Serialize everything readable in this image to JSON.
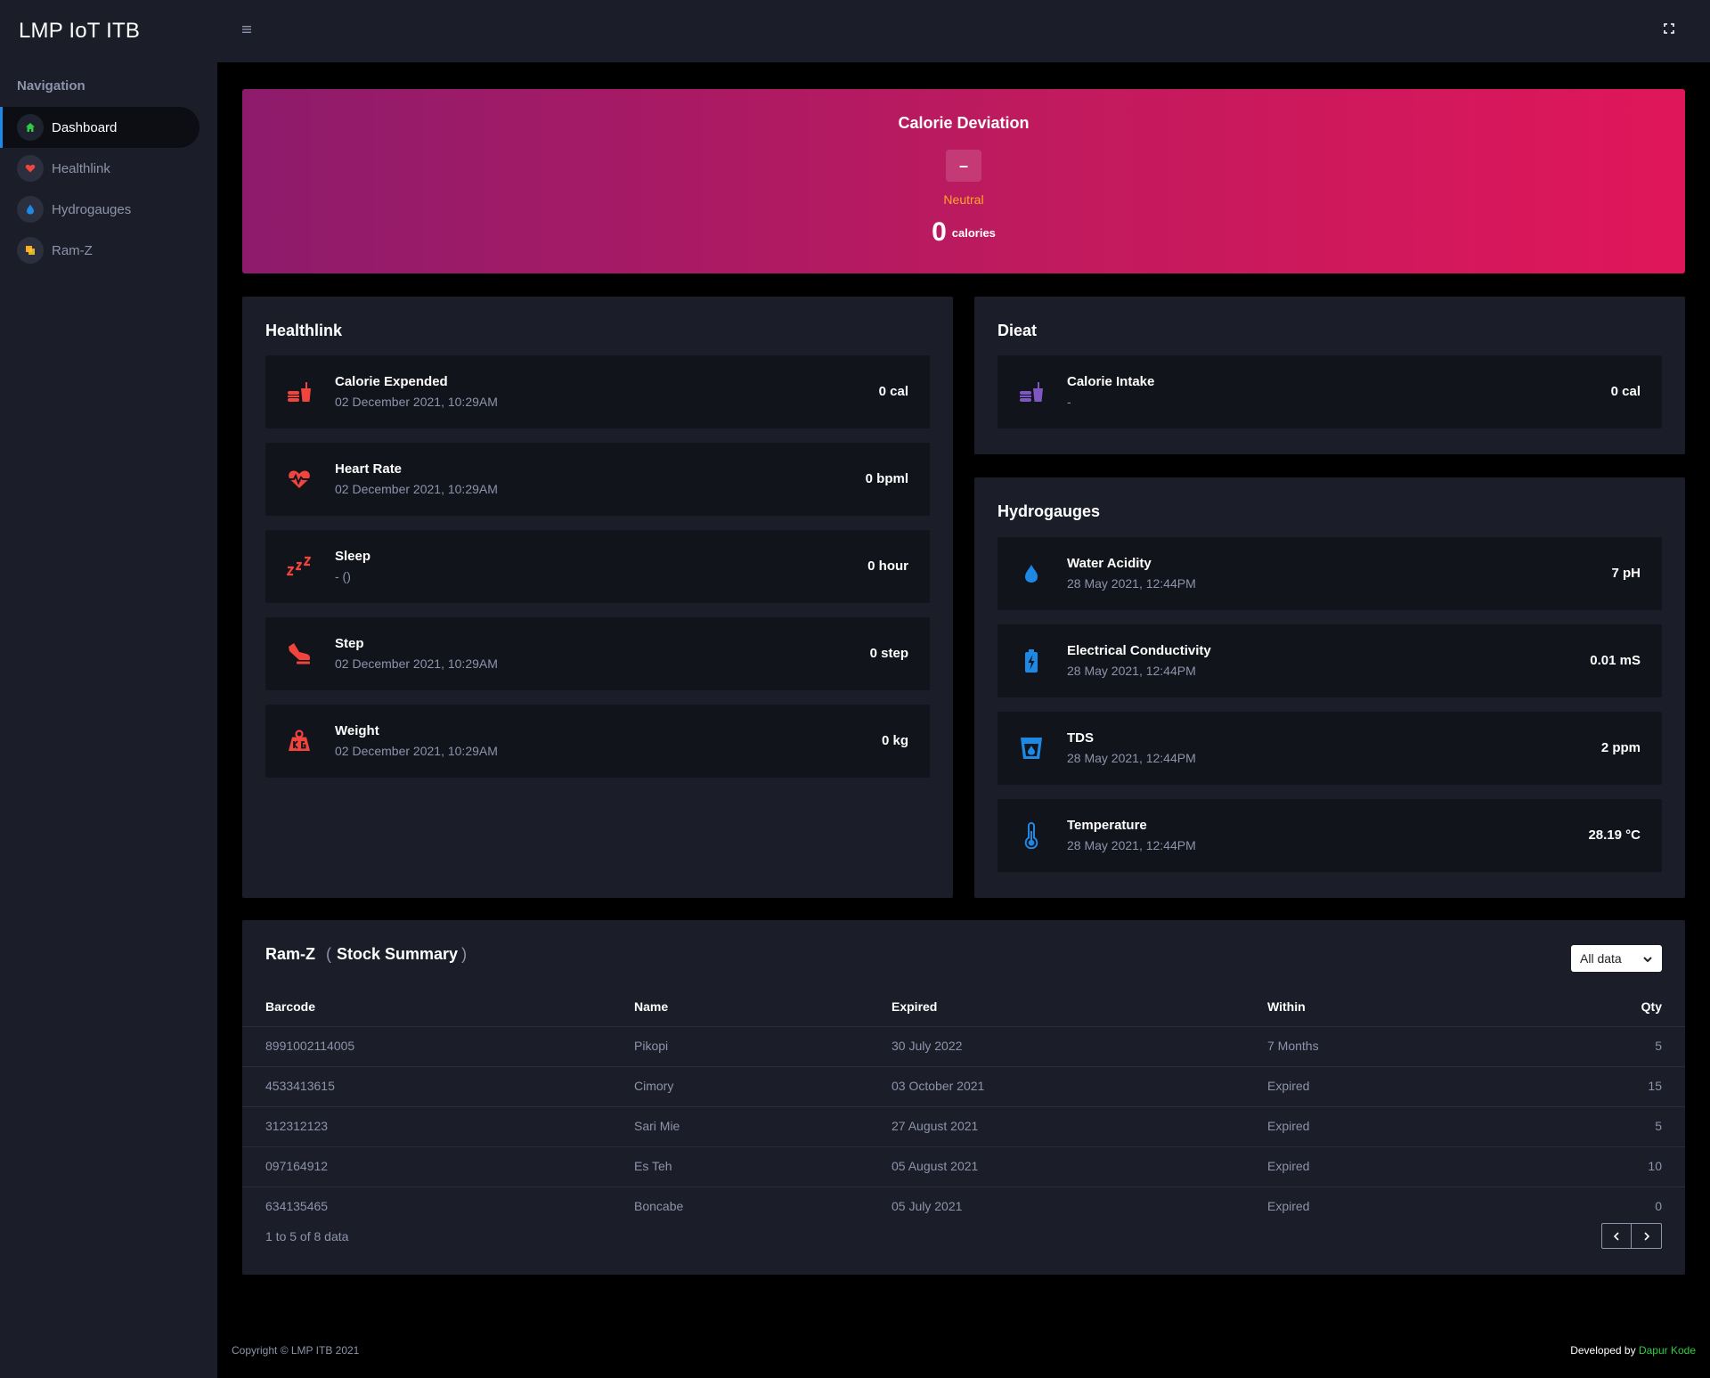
{
  "app": {
    "title": "LMP IoT ITB"
  },
  "sidebar": {
    "nav_title": "Navigation",
    "items": [
      {
        "label": "Dashboard",
        "icon": "home-icon",
        "active": true
      },
      {
        "label": "Healthlink",
        "icon": "heart-icon",
        "active": false
      },
      {
        "label": "Hydrogauges",
        "icon": "water-drop-icon",
        "active": false
      },
      {
        "label": "Ram-Z",
        "icon": "box-icon",
        "active": false
      }
    ]
  },
  "colors": {
    "sidebar_bg": "#1b1e29",
    "main_bg": "#000000",
    "card_inner_bg": "#12141c",
    "accent_blue": "#1e88e5",
    "health_red": "#f0443d",
    "diet_purple": "#7e57c2",
    "hydro_blue": "#1e88e5",
    "neutral_orange": "#ffa726",
    "footer_green": "#2ecc40",
    "hero_gradient_start": "#8d1b6c",
    "hero_gradient_end": "#e0165a"
  },
  "calorie_deviation": {
    "title": "Calorie Deviation",
    "badge_symbol": "–",
    "status": "Neutral",
    "value": "0",
    "unit": "calories"
  },
  "healthlink": {
    "title": "Healthlink",
    "items": [
      {
        "label": "Calorie Expended",
        "sub": "02 December 2021, 10:29AM",
        "value": "0 cal",
        "icon": "fastfood-icon"
      },
      {
        "label": "Heart Rate",
        "sub": "02 December 2021, 10:29AM",
        "value": "0 bpml",
        "icon": "heart-rate-icon"
      },
      {
        "label": "Sleep",
        "sub": "- ()",
        "value": "0 hour",
        "icon": "sleep-zzz-icon"
      },
      {
        "label": "Step",
        "sub": "02 December 2021, 10:29AM",
        "value": "0 step",
        "icon": "step-icon"
      },
      {
        "label": "Weight",
        "sub": "02 December 2021, 10:29AM",
        "value": "0 kg",
        "icon": "weight-kg-icon"
      }
    ]
  },
  "dieat": {
    "title": "Dieat",
    "items": [
      {
        "label": "Calorie Intake",
        "sub": "-",
        "value": "0 cal",
        "icon": "fastfood-icon"
      }
    ]
  },
  "hydrogauges": {
    "title": "Hydrogauges",
    "items": [
      {
        "label": "Water Acidity",
        "sub": "28 May 2021, 12:44PM",
        "value": "7 pH",
        "icon": "water-drop-icon"
      },
      {
        "label": "Electrical Conductivity",
        "sub": "28 May 2021, 12:44PM",
        "value": "0.01 mS",
        "icon": "battery-bolt-icon"
      },
      {
        "label": "TDS",
        "sub": "28 May 2021, 12:44PM",
        "value": "2 ppm",
        "icon": "glass-water-icon"
      },
      {
        "label": "Temperature",
        "sub": "28 May 2021, 12:44PM",
        "value": "28.19 °C",
        "icon": "thermometer-icon"
      }
    ]
  },
  "ramz": {
    "title": "Ram-Z",
    "paren_open": "(",
    "subtitle": "Stock Summary",
    "paren_close": ")",
    "filter": {
      "selected": "All data"
    },
    "columns": [
      "Barcode",
      "Name",
      "Expired",
      "Within",
      "Qty"
    ],
    "rows": [
      [
        "8991002114005",
        "Pikopi",
        "30 July 2022",
        "7 Months",
        "5"
      ],
      [
        "4533413615",
        "Cimory",
        "03 October 2021",
        "Expired",
        "15"
      ],
      [
        "312312123",
        "Sari Mie",
        "27 August 2021",
        "Expired",
        "5"
      ],
      [
        "097164912",
        "Es Teh",
        "05 August 2021",
        "Expired",
        "10"
      ],
      [
        "634135465",
        "Boncabe",
        "05 July 2021",
        "Expired",
        "0"
      ]
    ],
    "info": "1 to 5 of 8 data"
  },
  "footer": {
    "copyright": "Copyright © LMP ITB 2021",
    "developed_by": "Developed by",
    "developer": "Dapur Kode"
  }
}
